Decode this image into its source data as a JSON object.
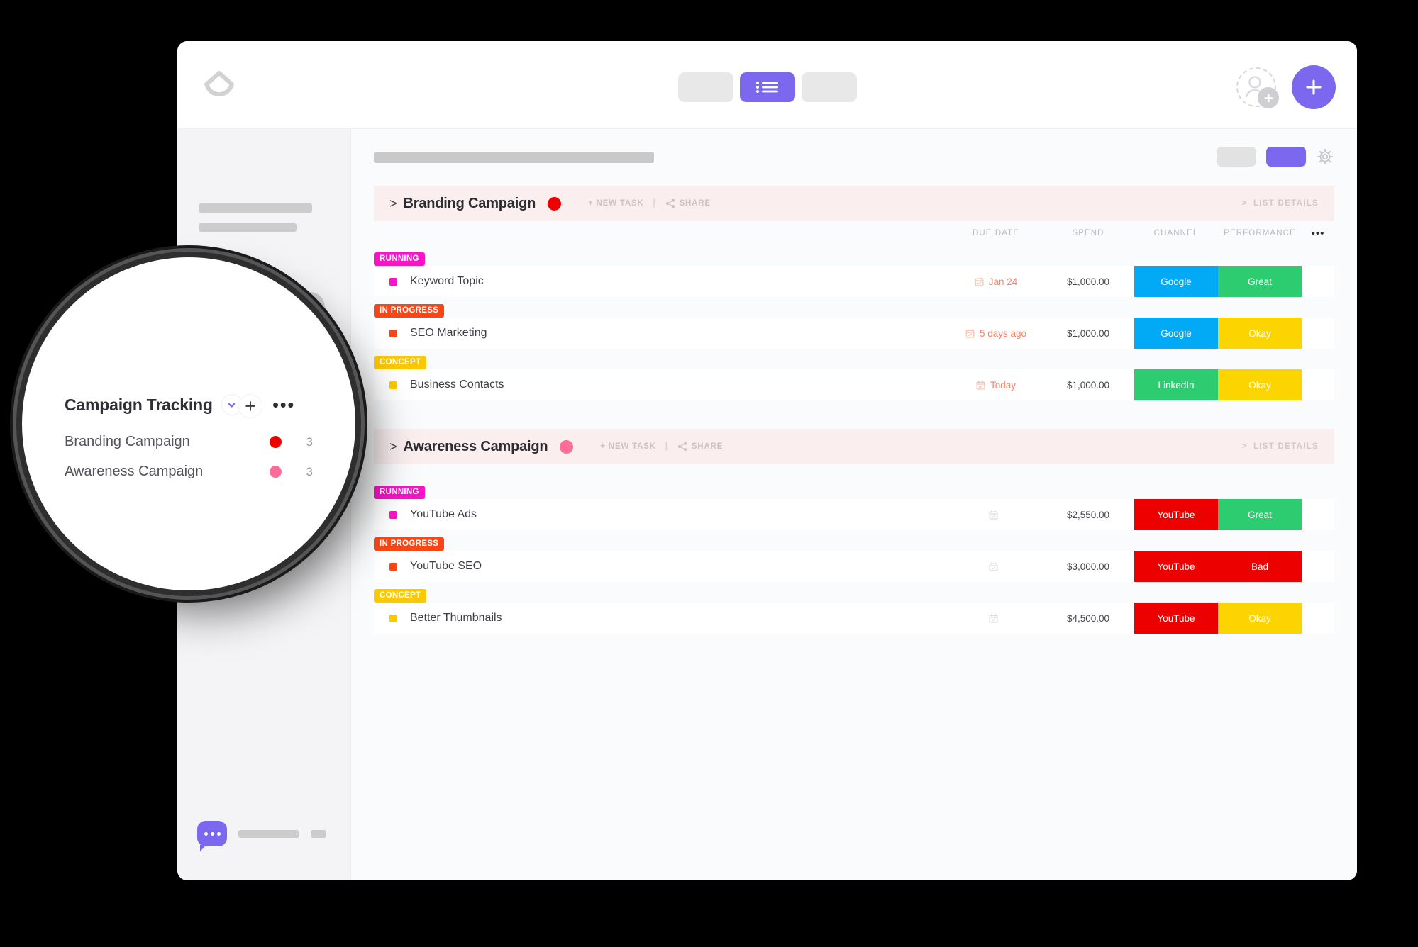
{
  "theme": {
    "accent": "#7b68ee",
    "group_header_bg": "#fbeeef",
    "page_bg": "#fafbfc"
  },
  "topbar": {
    "logo_name": "app-logo",
    "view_toggle": {
      "left_placeholder": "",
      "active_view": "list",
      "right_placeholder": ""
    },
    "invite_label": "",
    "add_label": "+"
  },
  "sidebar": {
    "search_placeholder": "",
    "chat_label": ""
  },
  "main": {
    "toolbar": {
      "settings_icon": "gear-icon"
    },
    "columns": {
      "name": "",
      "due_date": "DUE DATE",
      "spend": "SPEND",
      "channel": "CHANNEL",
      "performance": "PERFORMANCE",
      "more": "•••"
    },
    "groups": [
      {
        "caret": ">",
        "title": "Branding Campaign",
        "dot_color": "#ef0000",
        "new_task_label": "+ NEW TASK",
        "separator": "|",
        "share_label": "SHARE",
        "details_label": "LIST DETAILS",
        "details_caret": ">",
        "rows": [
          {
            "status": "RUNNING",
            "status_color": "#fc12c9",
            "name": "Keyword Topic",
            "due_date": "Jan 24",
            "spend": "$1,000.00",
            "channel": "Google",
            "channel_color": "#02a9f4",
            "performance": "Great",
            "performance_color": "#2ecc71"
          },
          {
            "status": "IN PROGRESS",
            "status_color": "#fa4616",
            "name": "SEO Marketing",
            "due_date": "5 days ago",
            "spend": "$1,000.00",
            "channel": "Google",
            "channel_color": "#02a9f4",
            "performance": "Okay",
            "performance_color": "#fcd500"
          },
          {
            "status": "CONCEPT",
            "status_color": "#fcc800",
            "name": "Business Contacts",
            "due_date": "Today",
            "spend": "$1,000.00",
            "channel": "LinkedIn",
            "channel_color": "#2ecc71",
            "performance": "Okay",
            "performance_color": "#fcd500"
          }
        ]
      },
      {
        "caret": ">",
        "title": "Awareness Campaign",
        "dot_color": "#fd6d97",
        "new_task_label": "+ NEW TASK",
        "separator": "|",
        "share_label": "SHARE",
        "details_label": "LIST DETAILS",
        "details_caret": ">",
        "rows": [
          {
            "status": "RUNNING",
            "status_color": "#fc12c9",
            "name": "YouTube Ads",
            "due_date": "",
            "spend": "$2,550.00",
            "channel": "YouTube",
            "channel_color": "#ed0000",
            "performance": "Great",
            "performance_color": "#2ecc71"
          },
          {
            "status": "IN PROGRESS",
            "status_color": "#fa4616",
            "name": "YouTube SEO",
            "due_date": "",
            "spend": "$3,000.00",
            "channel": "YouTube",
            "channel_color": "#ed0000",
            "performance": "Bad",
            "performance_color": "#ed0000"
          },
          {
            "status": "CONCEPT",
            "status_color": "#fcc800",
            "name": "Better Thumbnails",
            "due_date": "",
            "spend": "$4,500.00",
            "channel": "YouTube",
            "channel_color": "#ed0000",
            "performance": "Okay",
            "performance_color": "#fcd500"
          }
        ]
      }
    ]
  },
  "magnifier": {
    "list_title": "Campaign Tracking",
    "plus_label": "+",
    "more_label": "•••",
    "items": [
      {
        "label": "Branding Campaign",
        "dot_color": "#ef0000",
        "count": "3"
      },
      {
        "label": "Awareness Campaign",
        "dot_color": "#fd6d97",
        "count": "3"
      }
    ]
  }
}
